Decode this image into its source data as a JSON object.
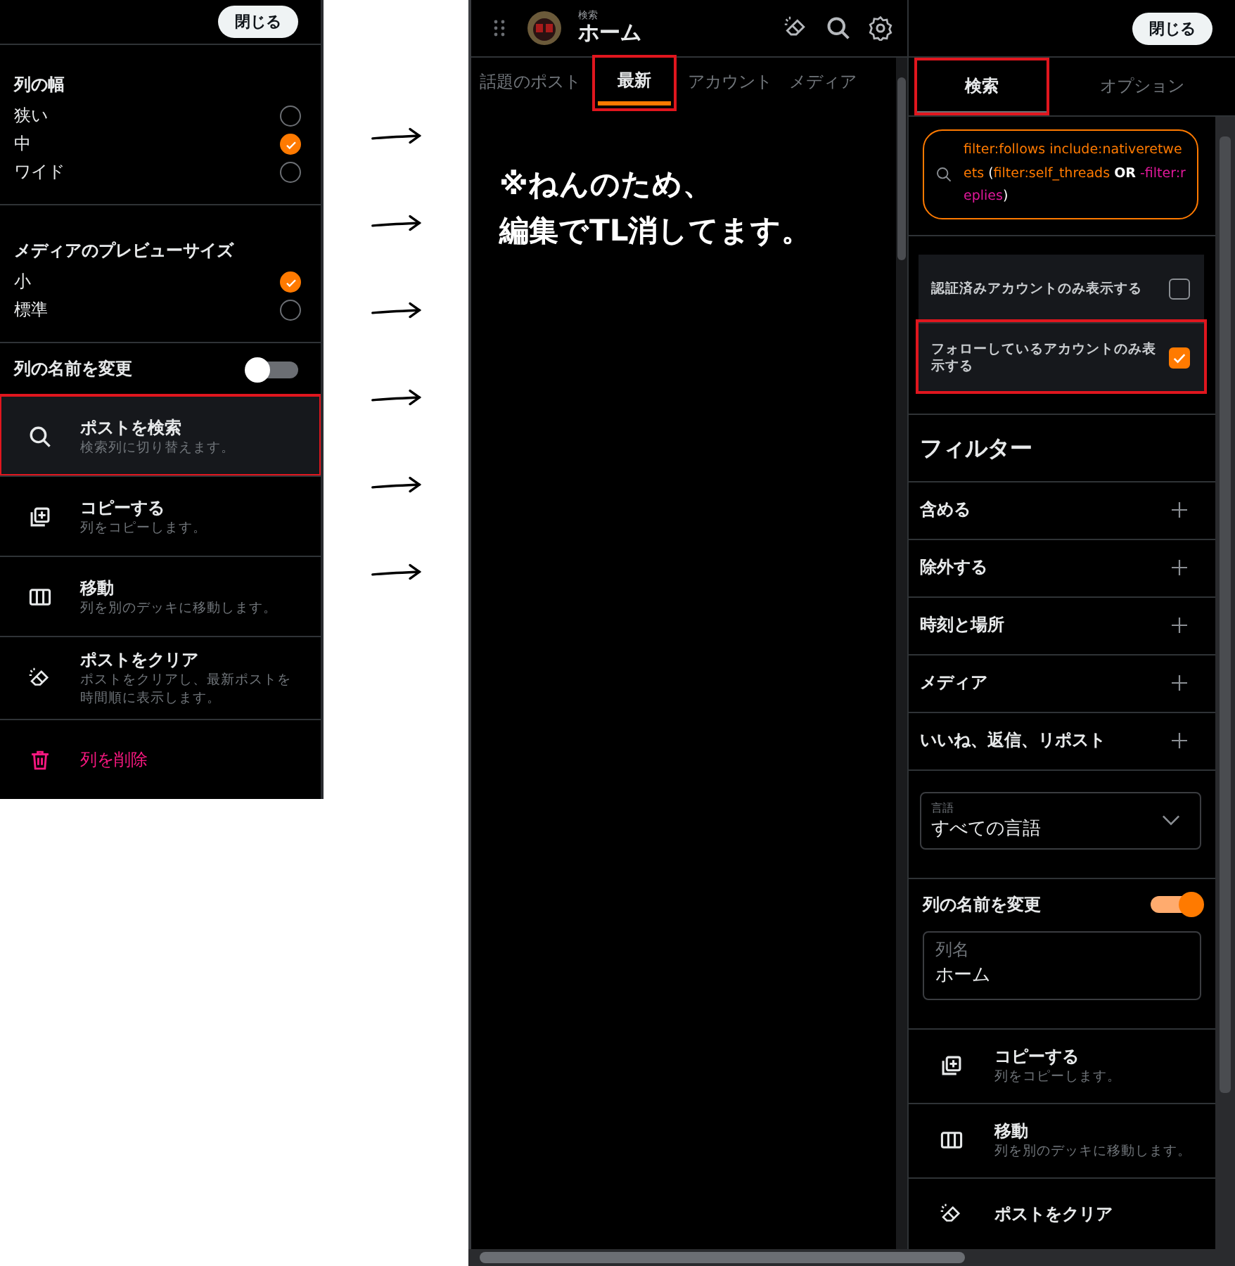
{
  "left_panel": {
    "close_button": "閉じる",
    "groups": [
      {
        "title": "列の幅",
        "options": [
          {
            "label": "狭い",
            "selected": false
          },
          {
            "label": "中",
            "selected": true
          },
          {
            "label": "ワイド",
            "selected": false
          }
        ]
      },
      {
        "title": "メディアのプレビューサイズ",
        "options": [
          {
            "label": "小",
            "selected": true
          },
          {
            "label": "標準",
            "selected": false
          }
        ]
      }
    ],
    "rename": {
      "label": "列の名前を変更",
      "on": false
    },
    "actions": [
      {
        "kind": "search",
        "title": "ポストを検索",
        "subtitle": "検索列に切り替えます。",
        "highlighted": true
      },
      {
        "kind": "copy",
        "title": "コピーする",
        "subtitle": "列をコピーします。",
        "highlighted": false
      },
      {
        "kind": "move",
        "title": "移動",
        "subtitle": "列を別のデッキに移動します。",
        "highlighted": false
      },
      {
        "kind": "clear",
        "title": "ポストをクリア",
        "subtitle": "ポストをクリアし、最新ポストを時間順に表示します。",
        "highlighted": false
      },
      {
        "kind": "delete",
        "title": "列を削除",
        "highlighted": false
      }
    ]
  },
  "column": {
    "subtitle": "検索",
    "title": "ホーム",
    "tabs": [
      {
        "label": "話題のポスト",
        "selected": false,
        "highlighted": false
      },
      {
        "label": "最新",
        "selected": true,
        "highlighted": true
      },
      {
        "label": "アカウント",
        "selected": false,
        "highlighted": false
      },
      {
        "label": "メディア",
        "selected": false,
        "highlighted": false
      }
    ],
    "note_lines": [
      "※ねんのため、",
      "編集でTL消してます。"
    ]
  },
  "settings_panel": {
    "close_button": "閉じる",
    "tabs": [
      {
        "label": "検索",
        "selected": true,
        "highlighted": true
      },
      {
        "label": "オプション",
        "selected": false,
        "highlighted": false
      }
    ],
    "query": [
      {
        "text": "filter:follows include:nativeretweets",
        "kind": "term"
      },
      {
        "text": "(",
        "kind": "open"
      },
      {
        "text": "filter:self_threads",
        "kind": "term"
      },
      {
        "text": "OR",
        "kind": "operator"
      },
      {
        "text": "-filter:replies",
        "kind": "negated"
      },
      {
        "text": ")",
        "kind": "close"
      }
    ],
    "checkboxes": [
      {
        "label": "認証済みアカウントのみ表示する",
        "checked": false,
        "highlighted": false
      },
      {
        "label": "フォローしているアカウントのみ表示する",
        "checked": true,
        "highlighted": true
      }
    ],
    "filter_title": "フィルター",
    "filters": [
      "含める",
      "除外する",
      "時刻と場所",
      "メディア",
      "いいね、返信、リポスト"
    ],
    "language": {
      "label": "言語",
      "value": "すべての言語"
    },
    "rename": {
      "label": "列の名前を変更",
      "on": true
    },
    "name_field": {
      "label": "列名",
      "value": "ホーム"
    },
    "actions": [
      {
        "kind": "copy",
        "title": "コピーする",
        "subtitle": "列をコピーします。"
      },
      {
        "kind": "move",
        "title": "移動",
        "subtitle": "列を別のデッキに移動します。"
      },
      {
        "kind": "clear",
        "title": "ポストをクリア"
      }
    ]
  }
}
